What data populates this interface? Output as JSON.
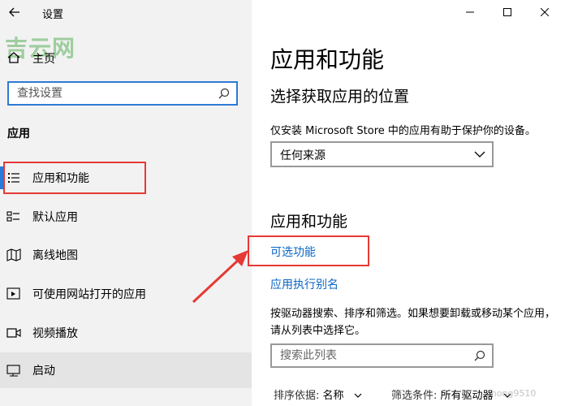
{
  "window": {
    "title": "设置",
    "controls": [
      "minimize-icon",
      "maximize-icon",
      "close-icon"
    ]
  },
  "watermark": {
    "brand": "吉云网",
    "corner": "ohong9510"
  },
  "sidebar": {
    "home_label": "主页",
    "search": {
      "placeholder": "查找设置"
    },
    "section": "应用",
    "items": [
      {
        "label": "应用和功能",
        "icon": "apps-features-icon",
        "selected": true
      },
      {
        "label": "默认应用",
        "icon": "default-apps-icon"
      },
      {
        "label": "离线地图",
        "icon": "offline-maps-icon"
      },
      {
        "label": "可使用网站打开的应用",
        "icon": "apps-for-websites-icon"
      },
      {
        "label": "视频播放",
        "icon": "video-playback-icon"
      },
      {
        "label": "启动",
        "icon": "startup-icon",
        "hover": true
      }
    ]
  },
  "main": {
    "title": "应用和功能",
    "choose_section": {
      "heading": "选择获取应用的位置",
      "description": "仅安装 Microsoft Store 中的应用有助于保护你的设备。",
      "dropdown_value": "任何来源"
    },
    "apps_section": {
      "heading": "应用和功能",
      "link_optional": "可选功能",
      "link_alias": "应用执行别名",
      "description": "按驱动器搜索、排序和筛选。如果想要卸载或移动某个应用，请从列表中选择它。",
      "search_placeholder": "搜索此列表",
      "sort_label": "排序依据:",
      "sort_value": "名称",
      "filter_label": "筛选条件:",
      "filter_value": "所有驱动器"
    }
  },
  "colors": {
    "accent": "#2c7ad6",
    "link": "#0a66c2",
    "annotation": "#e53935"
  }
}
